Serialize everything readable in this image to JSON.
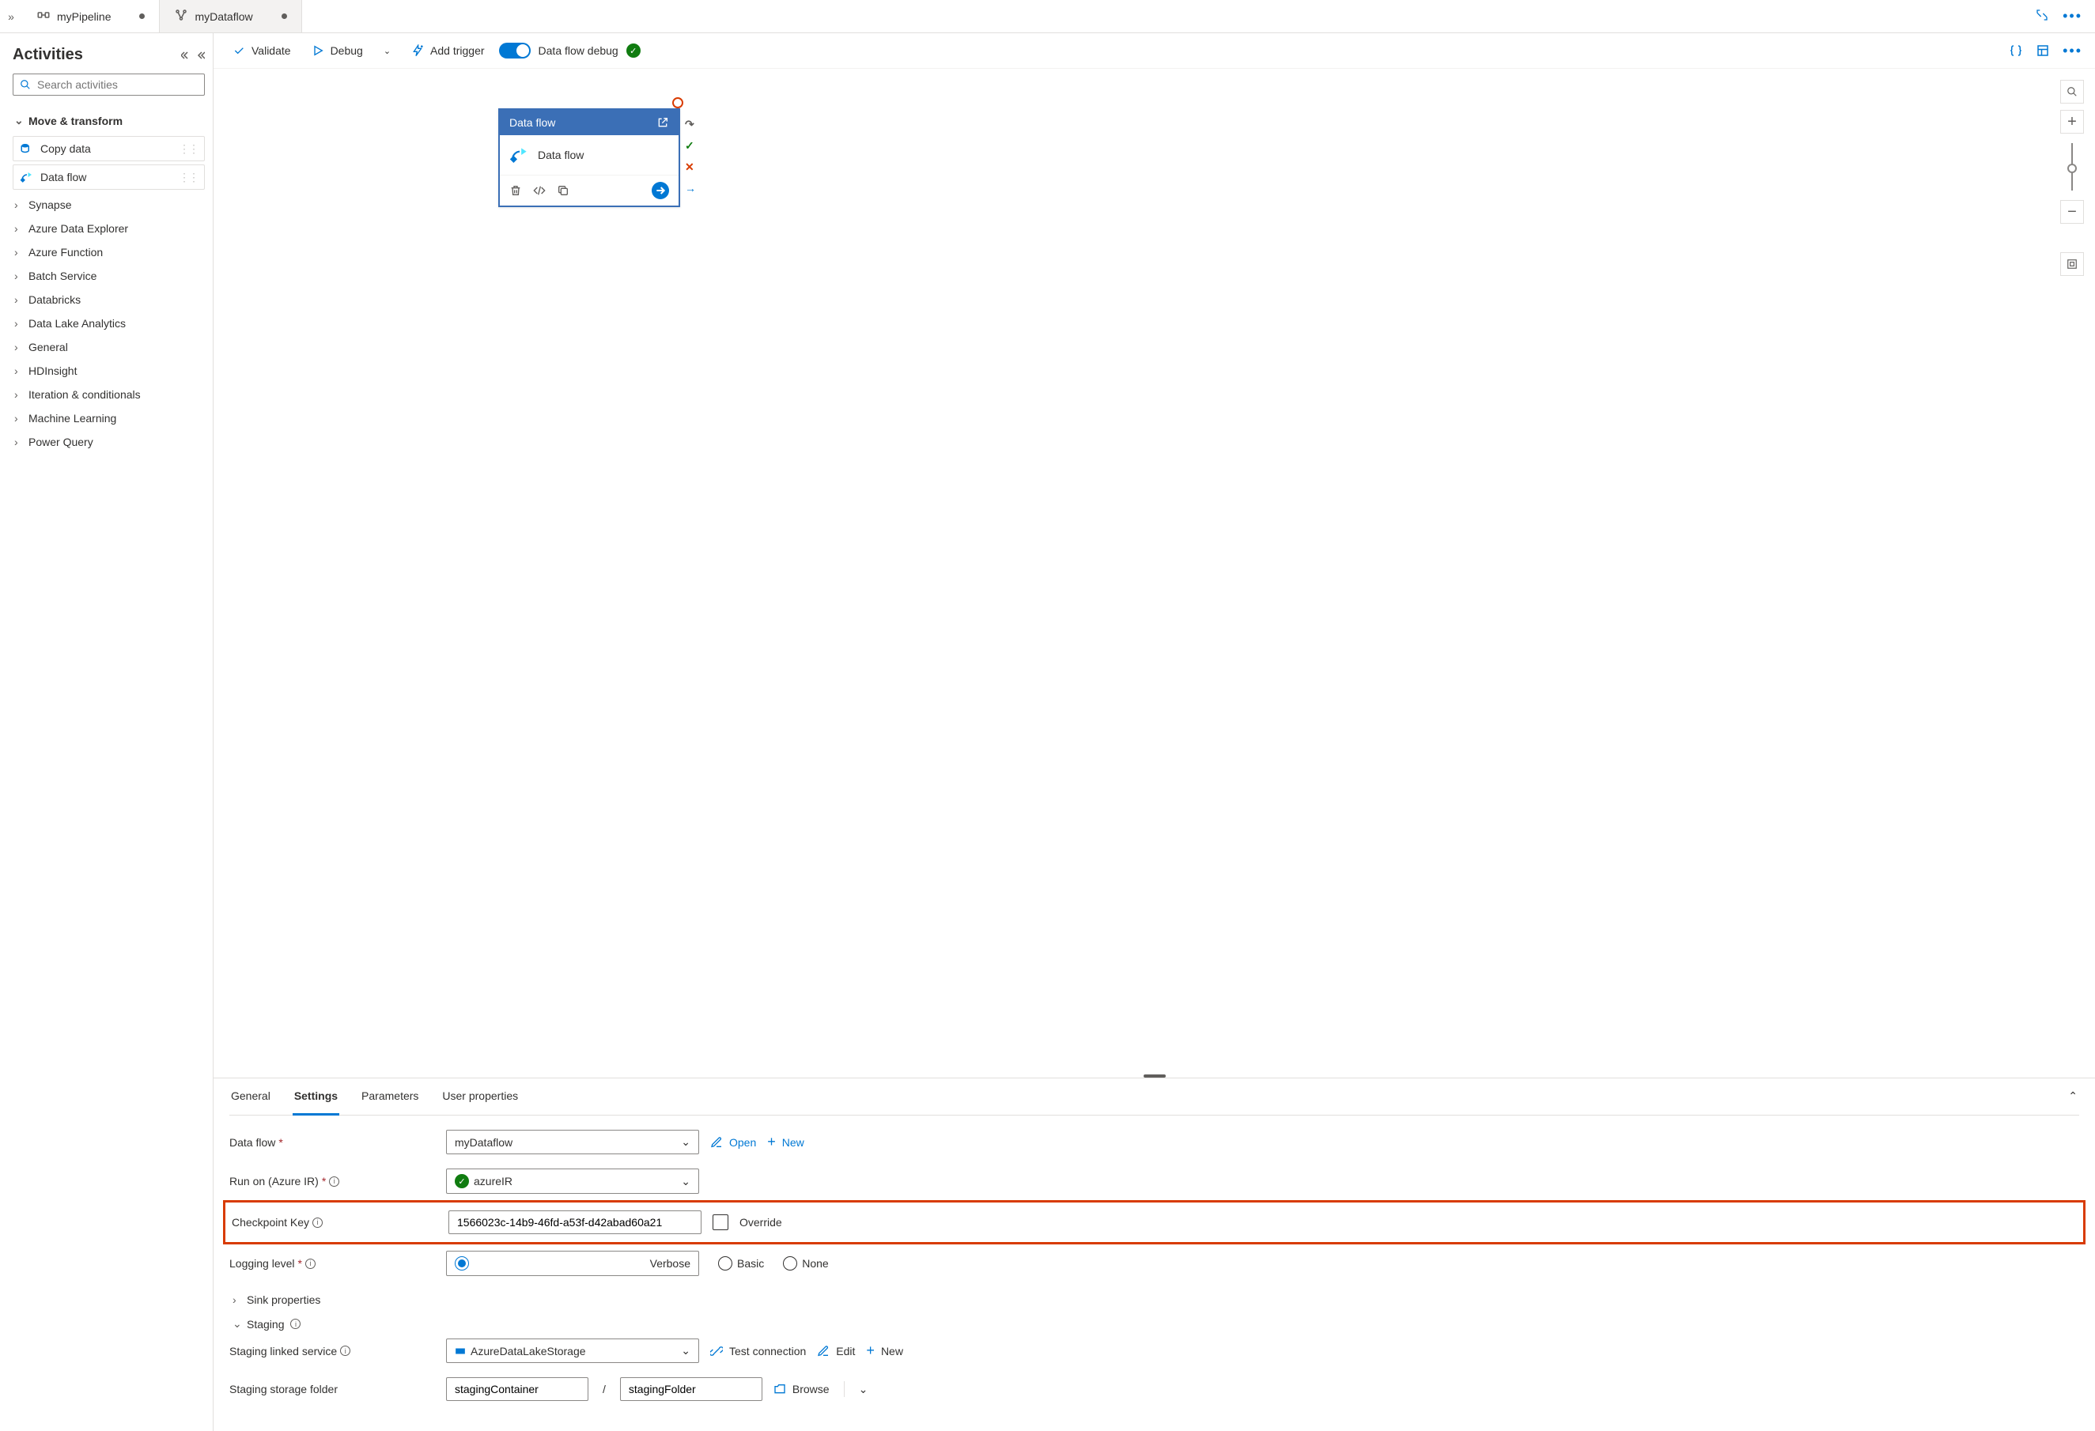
{
  "tabs": [
    {
      "label": "myPipeline",
      "modified": true,
      "icon": "pipeline"
    },
    {
      "label": "myDataflow",
      "modified": true,
      "icon": "dataflow"
    }
  ],
  "sidebar": {
    "title": "Activities",
    "search_placeholder": "Search activities",
    "groups": {
      "move_transform": {
        "label": "Move & transform",
        "expanded": true
      },
      "items": [
        {
          "label": "Copy data",
          "icon": "copy-data"
        },
        {
          "label": "Data flow",
          "icon": "dataflow"
        }
      ],
      "collapsed": [
        "Synapse",
        "Azure Data Explorer",
        "Azure Function",
        "Batch Service",
        "Databricks",
        "Data Lake Analytics",
        "General",
        "HDInsight",
        "Iteration & conditionals",
        "Machine Learning",
        "Power Query"
      ]
    }
  },
  "toolbar": {
    "validate": "Validate",
    "debug": "Debug",
    "add_trigger": "Add trigger",
    "dataflow_debug": "Data flow debug"
  },
  "canvas_node": {
    "header": "Data flow",
    "title": "Data flow"
  },
  "props": {
    "tabs": [
      "General",
      "Settings",
      "Parameters",
      "User properties"
    ],
    "active_tab": 1,
    "data_flow": {
      "label": "Data flow",
      "value": "myDataflow",
      "open": "Open",
      "new": "New"
    },
    "run_on": {
      "label": "Run on (Azure IR)",
      "value": "azureIR"
    },
    "checkpoint": {
      "label": "Checkpoint Key",
      "value": "1566023c-14b9-46fd-a53f-d42abad60a21",
      "override": "Override"
    },
    "logging": {
      "label": "Logging level",
      "options": [
        "Verbose",
        "Basic",
        "None"
      ],
      "selected": 0
    },
    "sink": "Sink properties",
    "staging": "Staging",
    "staging_svc": {
      "label": "Staging linked service",
      "value": "AzureDataLakeStorage",
      "test": "Test connection",
      "edit": "Edit",
      "new": "New"
    },
    "staging_folder": {
      "label": "Staging storage folder",
      "container": "stagingContainer",
      "folder": "stagingFolder",
      "browse": "Browse"
    }
  }
}
